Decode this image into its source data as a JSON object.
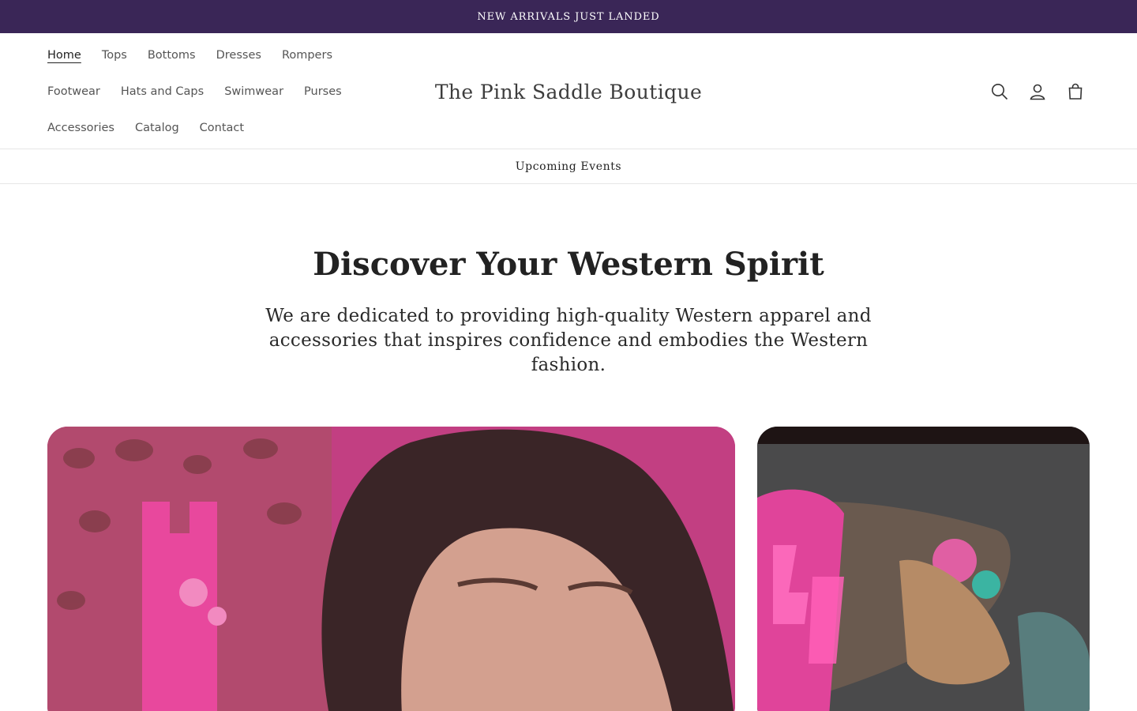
{
  "announcement": {
    "text": "NEW ARRIVALS JUST LANDED"
  },
  "header": {
    "logo": "The Pink Saddle Boutique",
    "nav_rows": [
      [
        {
          "label": "Home",
          "active": true
        },
        {
          "label": "Tops"
        },
        {
          "label": "Bottoms"
        },
        {
          "label": "Dresses"
        },
        {
          "label": "Rompers"
        }
      ],
      [
        {
          "label": "Footwear"
        },
        {
          "label": "Hats and Caps"
        },
        {
          "label": "Swimwear"
        },
        {
          "label": "Purses"
        }
      ],
      [
        {
          "label": "Accessories"
        },
        {
          "label": "Catalog"
        },
        {
          "label": "Contact"
        }
      ]
    ],
    "icons": [
      "search-icon",
      "account-icon",
      "cart-icon"
    ]
  },
  "subnav": {
    "label": "Upcoming Events"
  },
  "hero": {
    "title": "Discover Your Western Spirit",
    "subtitle": "We are dedicated to providing high-quality Western apparel and accessories that inspires confidence and embodies the Western fashion."
  },
  "colors": {
    "announcement_bg": "#3a2657",
    "accent_pink": "#e0449a"
  }
}
